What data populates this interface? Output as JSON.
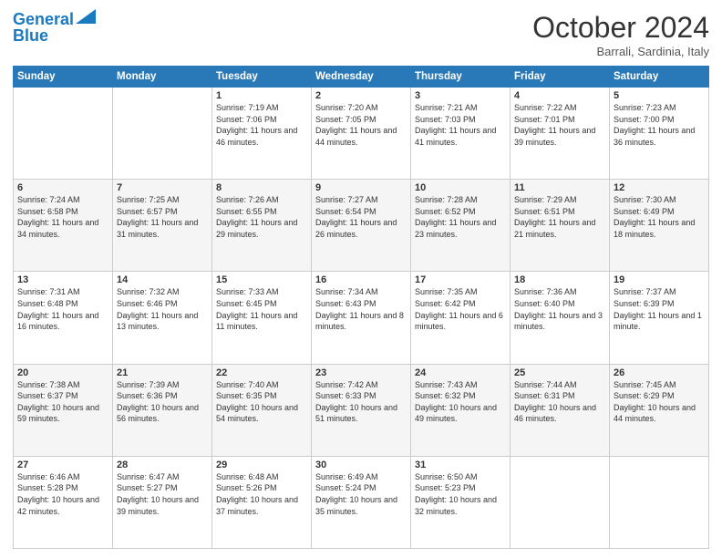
{
  "logo": {
    "line1": "General",
    "line2": "Blue"
  },
  "title": "October 2024",
  "subtitle": "Barrali, Sardinia, Italy",
  "weekdays": [
    "Sunday",
    "Monday",
    "Tuesday",
    "Wednesday",
    "Thursday",
    "Friday",
    "Saturday"
  ],
  "weeks": [
    [
      {
        "day": "",
        "info": ""
      },
      {
        "day": "",
        "info": ""
      },
      {
        "day": "1",
        "info": "Sunrise: 7:19 AM\nSunset: 7:06 PM\nDaylight: 11 hours and 46 minutes."
      },
      {
        "day": "2",
        "info": "Sunrise: 7:20 AM\nSunset: 7:05 PM\nDaylight: 11 hours and 44 minutes."
      },
      {
        "day": "3",
        "info": "Sunrise: 7:21 AM\nSunset: 7:03 PM\nDaylight: 11 hours and 41 minutes."
      },
      {
        "day": "4",
        "info": "Sunrise: 7:22 AM\nSunset: 7:01 PM\nDaylight: 11 hours and 39 minutes."
      },
      {
        "day": "5",
        "info": "Sunrise: 7:23 AM\nSunset: 7:00 PM\nDaylight: 11 hours and 36 minutes."
      }
    ],
    [
      {
        "day": "6",
        "info": "Sunrise: 7:24 AM\nSunset: 6:58 PM\nDaylight: 11 hours and 34 minutes."
      },
      {
        "day": "7",
        "info": "Sunrise: 7:25 AM\nSunset: 6:57 PM\nDaylight: 11 hours and 31 minutes."
      },
      {
        "day": "8",
        "info": "Sunrise: 7:26 AM\nSunset: 6:55 PM\nDaylight: 11 hours and 29 minutes."
      },
      {
        "day": "9",
        "info": "Sunrise: 7:27 AM\nSunset: 6:54 PM\nDaylight: 11 hours and 26 minutes."
      },
      {
        "day": "10",
        "info": "Sunrise: 7:28 AM\nSunset: 6:52 PM\nDaylight: 11 hours and 23 minutes."
      },
      {
        "day": "11",
        "info": "Sunrise: 7:29 AM\nSunset: 6:51 PM\nDaylight: 11 hours and 21 minutes."
      },
      {
        "day": "12",
        "info": "Sunrise: 7:30 AM\nSunset: 6:49 PM\nDaylight: 11 hours and 18 minutes."
      }
    ],
    [
      {
        "day": "13",
        "info": "Sunrise: 7:31 AM\nSunset: 6:48 PM\nDaylight: 11 hours and 16 minutes."
      },
      {
        "day": "14",
        "info": "Sunrise: 7:32 AM\nSunset: 6:46 PM\nDaylight: 11 hours and 13 minutes."
      },
      {
        "day": "15",
        "info": "Sunrise: 7:33 AM\nSunset: 6:45 PM\nDaylight: 11 hours and 11 minutes."
      },
      {
        "day": "16",
        "info": "Sunrise: 7:34 AM\nSunset: 6:43 PM\nDaylight: 11 hours and 8 minutes."
      },
      {
        "day": "17",
        "info": "Sunrise: 7:35 AM\nSunset: 6:42 PM\nDaylight: 11 hours and 6 minutes."
      },
      {
        "day": "18",
        "info": "Sunrise: 7:36 AM\nSunset: 6:40 PM\nDaylight: 11 hours and 3 minutes."
      },
      {
        "day": "19",
        "info": "Sunrise: 7:37 AM\nSunset: 6:39 PM\nDaylight: 11 hours and 1 minute."
      }
    ],
    [
      {
        "day": "20",
        "info": "Sunrise: 7:38 AM\nSunset: 6:37 PM\nDaylight: 10 hours and 59 minutes."
      },
      {
        "day": "21",
        "info": "Sunrise: 7:39 AM\nSunset: 6:36 PM\nDaylight: 10 hours and 56 minutes."
      },
      {
        "day": "22",
        "info": "Sunrise: 7:40 AM\nSunset: 6:35 PM\nDaylight: 10 hours and 54 minutes."
      },
      {
        "day": "23",
        "info": "Sunrise: 7:42 AM\nSunset: 6:33 PM\nDaylight: 10 hours and 51 minutes."
      },
      {
        "day": "24",
        "info": "Sunrise: 7:43 AM\nSunset: 6:32 PM\nDaylight: 10 hours and 49 minutes."
      },
      {
        "day": "25",
        "info": "Sunrise: 7:44 AM\nSunset: 6:31 PM\nDaylight: 10 hours and 46 minutes."
      },
      {
        "day": "26",
        "info": "Sunrise: 7:45 AM\nSunset: 6:29 PM\nDaylight: 10 hours and 44 minutes."
      }
    ],
    [
      {
        "day": "27",
        "info": "Sunrise: 6:46 AM\nSunset: 5:28 PM\nDaylight: 10 hours and 42 minutes."
      },
      {
        "day": "28",
        "info": "Sunrise: 6:47 AM\nSunset: 5:27 PM\nDaylight: 10 hours and 39 minutes."
      },
      {
        "day": "29",
        "info": "Sunrise: 6:48 AM\nSunset: 5:26 PM\nDaylight: 10 hours and 37 minutes."
      },
      {
        "day": "30",
        "info": "Sunrise: 6:49 AM\nSunset: 5:24 PM\nDaylight: 10 hours and 35 minutes."
      },
      {
        "day": "31",
        "info": "Sunrise: 6:50 AM\nSunset: 5:23 PM\nDaylight: 10 hours and 32 minutes."
      },
      {
        "day": "",
        "info": ""
      },
      {
        "day": "",
        "info": ""
      }
    ]
  ]
}
